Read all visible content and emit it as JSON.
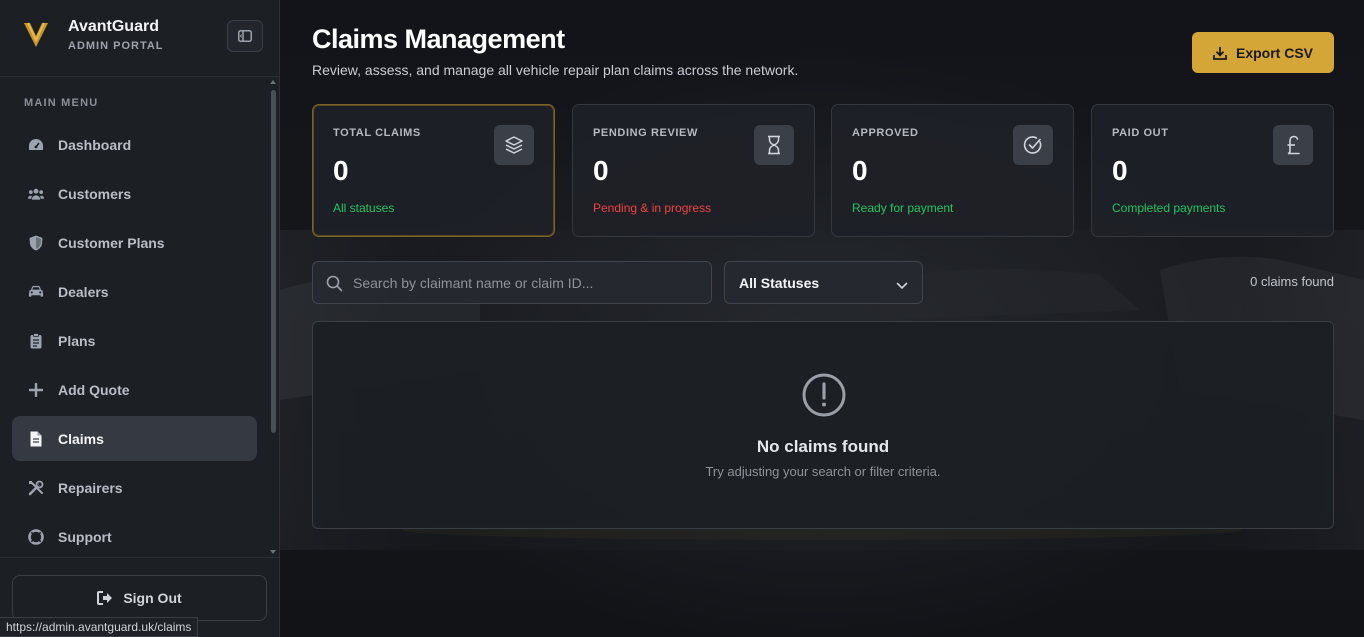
{
  "brand": {
    "name": "AvantGuard",
    "subtitle": "ADMIN PORTAL"
  },
  "sidebar": {
    "menu_title": "MAIN MENU",
    "items": [
      {
        "label": "Dashboard",
        "icon": "gauge-icon"
      },
      {
        "label": "Customers",
        "icon": "users-icon"
      },
      {
        "label": "Customer Plans",
        "icon": "shield-icon"
      },
      {
        "label": "Dealers",
        "icon": "car-icon"
      },
      {
        "label": "Plans",
        "icon": "clipboard-icon"
      },
      {
        "label": "Add Quote",
        "icon": "plus-icon"
      },
      {
        "label": "Claims",
        "icon": "file-icon",
        "active": true
      },
      {
        "label": "Repairers",
        "icon": "tools-icon"
      },
      {
        "label": "Support",
        "icon": "lifebuoy-icon"
      }
    ],
    "sign_out": "Sign Out"
  },
  "status_url": "https://admin.avantguard.uk/claims",
  "header": {
    "title": "Claims Management",
    "subtitle": "Review, assess, and manage all vehicle repair plan claims across the network.",
    "export_label": "Export CSV"
  },
  "stats": [
    {
      "label": "TOTAL CLAIMS",
      "value": "0",
      "note": "All statuses",
      "note_color": "#22c55e",
      "icon": "layers-icon"
    },
    {
      "label": "PENDING REVIEW",
      "value": "0",
      "note": "Pending & in progress",
      "note_color": "#ef4444",
      "icon": "hourglass-icon"
    },
    {
      "label": "APPROVED",
      "value": "0",
      "note": "Ready for payment",
      "note_color": "#22c55e",
      "icon": "check-circle-icon"
    },
    {
      "label": "PAID OUT",
      "value": "0",
      "note": "Completed payments",
      "note_color": "#22c55e",
      "icon": "pound-icon"
    }
  ],
  "filters": {
    "search_placeholder": "Search by claimant name or claim ID...",
    "status_selected": "All Statuses",
    "count_text": "0 claims found"
  },
  "empty": {
    "title": "No claims found",
    "subtitle": "Try adjusting your search or filter criteria."
  },
  "colors": {
    "accent": "#d4a537",
    "positive": "#22c55e",
    "negative": "#ef4444"
  }
}
